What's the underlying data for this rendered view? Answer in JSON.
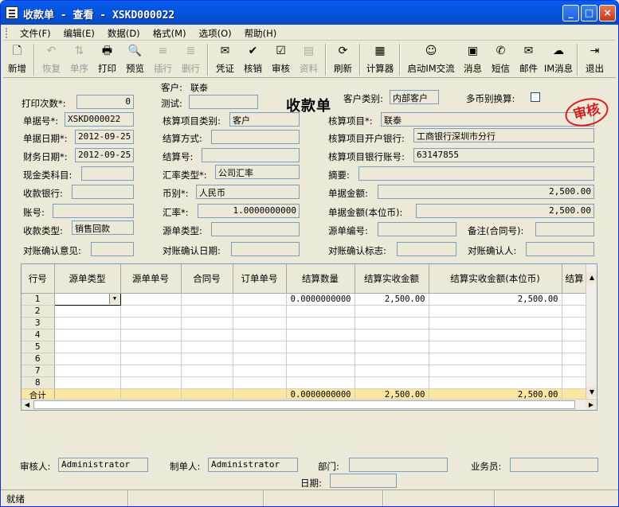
{
  "window": {
    "title": "收款单 - 查看 - XSKD000022"
  },
  "menu": [
    "文件(F)",
    "编辑(E)",
    "数据(D)",
    "格式(M)",
    "选项(O)",
    "帮助(H)"
  ],
  "toolbar": [
    {
      "label": "新增",
      "icon": "new-doc-icon",
      "glyph": "🗋",
      "enabled": true
    },
    {
      "label": "恢复",
      "icon": "undo-icon",
      "glyph": "↶",
      "enabled": false
    },
    {
      "label": "单序",
      "icon": "sort-icon",
      "glyph": "⇅",
      "enabled": false
    },
    {
      "label": "打印",
      "icon": "printer-icon",
      "glyph": "🖶",
      "enabled": true
    },
    {
      "label": "预览",
      "icon": "preview-icon",
      "glyph": "🔍",
      "enabled": true
    },
    {
      "label": "插行",
      "icon": "insert-row-icon",
      "glyph": "≡",
      "enabled": false
    },
    {
      "label": "删行",
      "icon": "delete-row-icon",
      "glyph": "≣",
      "enabled": false
    },
    {
      "label": "凭证",
      "icon": "voucher-icon",
      "glyph": "✉",
      "enabled": true
    },
    {
      "label": "核销",
      "icon": "checkmark-icon",
      "glyph": "✔",
      "enabled": true
    },
    {
      "label": "审核",
      "icon": "audit-icon",
      "glyph": "☑",
      "enabled": true
    },
    {
      "label": "资料",
      "icon": "data-icon",
      "glyph": "▤",
      "enabled": false
    },
    {
      "label": "刷新",
      "icon": "refresh-icon",
      "glyph": "⟳",
      "enabled": true
    },
    {
      "label": "计算器",
      "icon": "calculator-icon",
      "glyph": "▦",
      "enabled": true
    },
    {
      "label": "启动IM交流",
      "icon": "im-chat-icon",
      "glyph": "☺",
      "enabled": true
    },
    {
      "label": "消息",
      "icon": "message-icon",
      "glyph": "▣",
      "enabled": true
    },
    {
      "label": "短信",
      "icon": "sms-icon",
      "glyph": "✆",
      "enabled": true
    },
    {
      "label": "邮件",
      "icon": "mail-icon",
      "glyph": "✉",
      "enabled": true
    },
    {
      "label": "IM消息",
      "icon": "im-message-icon",
      "glyph": "☁",
      "enabled": true
    },
    {
      "label": "退出",
      "icon": "exit-icon",
      "glyph": "⇥",
      "enabled": true
    }
  ],
  "form": {
    "title": "收款单",
    "stamp": "审核",
    "print_count_label": "打印次数*:",
    "print_count": "0",
    "customer_label": "客户:",
    "customer": "联泰",
    "test_label": "测试:",
    "test": "",
    "customer_type_label": "客户类别:",
    "customer_type": "内部客户",
    "multi_currency_label": "多币别换算:",
    "doc_no_label": "单据号*:",
    "doc_no": "XSKD000022",
    "acct_item_type_label": "核算项目类别:",
    "acct_item_type": "客户",
    "acct_item_label": "核算项目*:",
    "acct_item": "联泰",
    "doc_date_label": "单据日期*:",
    "doc_date": "2012-09-25",
    "settle_method_label": "结算方式:",
    "settle_method": "",
    "acct_bank_label": "核算项目开户银行:",
    "acct_bank": "工商银行深圳市分行",
    "fin_date_label": "财务日期*:",
    "fin_date": "2012-09-25",
    "settle_no_label": "结算号:",
    "settle_no": "",
    "acct_bank_no_label": "核算项目银行账号:",
    "acct_bank_no": "63147855",
    "cash_item_label": "现金类科目:",
    "cash_item": "",
    "rate_type_label": "汇率类型*:",
    "rate_type": "公司汇率",
    "summary_label": "摘要:",
    "summary": "",
    "bank_label": "收款银行:",
    "bank": "",
    "currency_label": "币别*:",
    "currency": "人民币",
    "amount_label": "单据金额:",
    "amount": "2,500.00",
    "account_label": "账号:",
    "account": "",
    "rate_label": "汇率*:",
    "rate": "1.0000000000",
    "amount_local_label": "单据金额(本位币):",
    "amount_local": "2,500.00",
    "recv_type_label": "收款类型:",
    "recv_type": "销售回款",
    "src_type_label": "源单类型:",
    "src_type": "",
    "src_no_label": "源单编号:",
    "src_no": "",
    "remark_label": "备注(合同号):",
    "remark": "",
    "recon_opinion_label": "对账确认意见:",
    "recon_opinion": "",
    "recon_date_label": "对账确认日期:",
    "recon_date": "",
    "recon_flag_label": "对账确认标志:",
    "recon_flag": "",
    "recon_person_label": "对账确认人:",
    "recon_person": ""
  },
  "grid": {
    "columns": [
      "行号",
      "源单类型",
      "源单单号",
      "合同号",
      "订单单号",
      "结算数量",
      "结算实收金额",
      "结算实收金额(本位币)",
      "结算"
    ],
    "rows": [
      {
        "n": "1",
        "qty": "0.0000000000",
        "amt": "2,500.00",
        "amt_local": "2,500.00"
      },
      {
        "n": "2",
        "qty": "",
        "amt": "",
        "amt_local": ""
      },
      {
        "n": "3",
        "qty": "",
        "amt": "",
        "amt_local": ""
      },
      {
        "n": "4",
        "qty": "",
        "amt": "",
        "amt_local": ""
      },
      {
        "n": "5",
        "qty": "",
        "amt": "",
        "amt_local": ""
      },
      {
        "n": "6",
        "qty": "",
        "amt": "",
        "amt_local": ""
      },
      {
        "n": "7",
        "qty": "",
        "amt": "",
        "amt_local": ""
      },
      {
        "n": "8",
        "qty": "",
        "amt": "",
        "amt_local": ""
      }
    ],
    "total": {
      "label": "合计",
      "qty": "0.0000000000",
      "amt": "2,500.00",
      "amt_local": "2,500.00"
    }
  },
  "footer": {
    "auditor_label": "审核人:",
    "auditor": "Administrator",
    "maker_label": "制单人:",
    "maker": "Administrator",
    "dept_label": "部门:",
    "dept": "",
    "salesman_label": "业务员:",
    "salesman": "",
    "date_label": "日期:",
    "date": ""
  },
  "status": {
    "text": "就绪"
  }
}
